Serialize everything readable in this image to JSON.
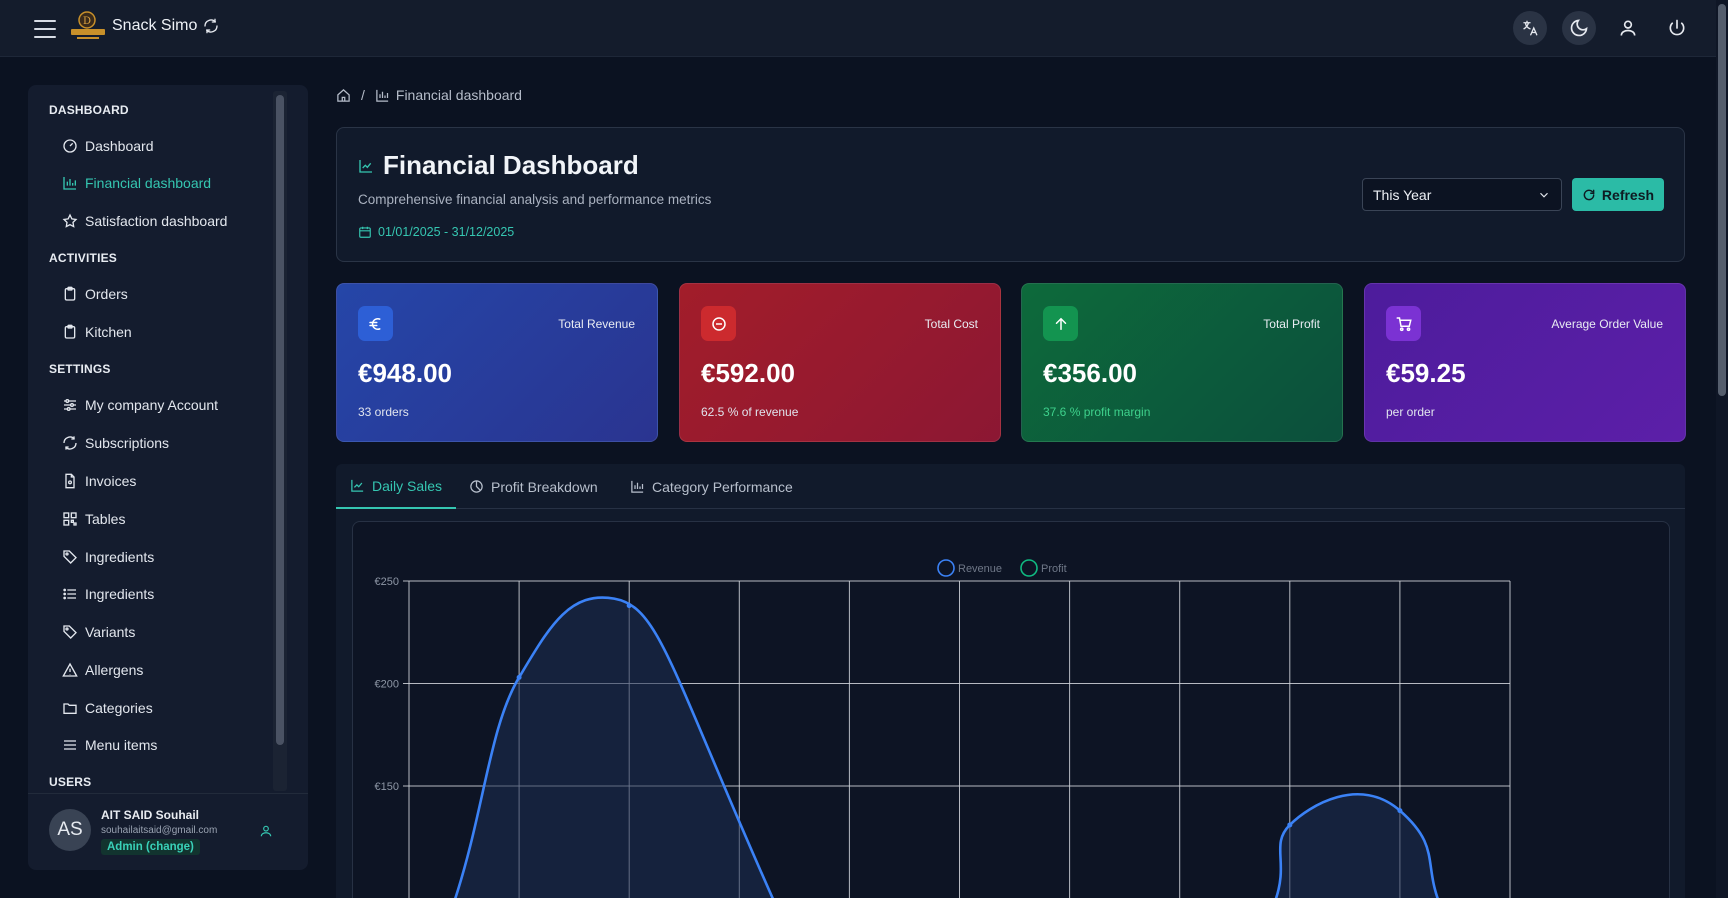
{
  "app": {
    "brand_name": "Snack Simo"
  },
  "breadcrumb": {
    "separator": "/",
    "current": "Financial dashboard"
  },
  "sidebar": {
    "sections": [
      {
        "title": "DASHBOARD"
      },
      {
        "title": "ACTIVITIES"
      },
      {
        "title": "SETTINGS"
      },
      {
        "title": "USERS"
      }
    ],
    "items": [
      {
        "label": "Dashboard",
        "icon": "gauge-icon"
      },
      {
        "label": "Financial dashboard",
        "icon": "bar-chart-icon",
        "active": true
      },
      {
        "label": "Satisfaction dashboard",
        "icon": "star-icon"
      },
      {
        "label": "Orders",
        "icon": "clipboard-icon"
      },
      {
        "label": "Kitchen",
        "icon": "clipboard-icon"
      },
      {
        "label": "My company Account",
        "icon": "sliders-icon"
      },
      {
        "label": "Subscriptions",
        "icon": "sync-icon"
      },
      {
        "label": "Invoices",
        "icon": "file-icon"
      },
      {
        "label": "Tables",
        "icon": "qr-grid-icon"
      },
      {
        "label": "Ingredients",
        "icon": "tag-icon"
      },
      {
        "label": "Ingredients",
        "icon": "list-icon"
      },
      {
        "label": "Variants",
        "icon": "tag-icon"
      },
      {
        "label": "Allergens",
        "icon": "warning-icon"
      },
      {
        "label": "Categories",
        "icon": "folder-icon"
      },
      {
        "label": "Menu items",
        "icon": "menu-icon"
      }
    ]
  },
  "user": {
    "initials": "AS",
    "name": "AIT SAID Souhail",
    "email": "souhailaitsaid@gmail.com",
    "role": "Admin (change)"
  },
  "header": {
    "title": "Financial Dashboard",
    "subtitle": "Comprehensive financial analysis and performance metrics",
    "date_range": "01/01/2025 - 31/12/2025",
    "period_selected": "This Year",
    "refresh_label": "Refresh"
  },
  "metrics": [
    {
      "label": "Total Revenue",
      "value": "€948.00",
      "sub": "33 orders",
      "icon": "euro-icon"
    },
    {
      "label": "Total Cost",
      "value": "€592.00",
      "sub": "62.5 % of revenue",
      "icon": "minus-circle-icon"
    },
    {
      "label": "Total Profit",
      "value": "€356.00",
      "sub": "37.6 % profit margin",
      "icon": "arrow-up-icon"
    },
    {
      "label": "Average Order Value",
      "value": "€59.25",
      "sub": "per order",
      "icon": "cart-icon"
    }
  ],
  "tabs": [
    {
      "label": "Daily Sales",
      "active": true
    },
    {
      "label": "Profit Breakdown"
    },
    {
      "label": "Category Performance"
    }
  ],
  "colors": {
    "accent": "#35c6b1",
    "revenue_line": "#3b82f6",
    "profit_line": "#10b981",
    "card_revenue": "#2a3f9c",
    "card_cost": "#9c1c33",
    "card_profit": "#0f5e3e",
    "card_aov": "#5b1fa3"
  },
  "chart_data": {
    "type": "line",
    "legend_position": "top-center",
    "grid": true,
    "y_tick_labels": [
      "€250",
      "€200",
      "€150"
    ],
    "ylim": [
      100,
      250
    ],
    "series": [
      {
        "name": "Revenue",
        "style": "smoothed filled area",
        "points": [
          {
            "x": 1,
            "y": 203
          },
          {
            "x": 2,
            "y": 238
          },
          {
            "x": 8,
            "y": 131
          },
          {
            "x": 9,
            "y": 138
          }
        ]
      },
      {
        "name": "Profit",
        "points": []
      }
    ]
  }
}
